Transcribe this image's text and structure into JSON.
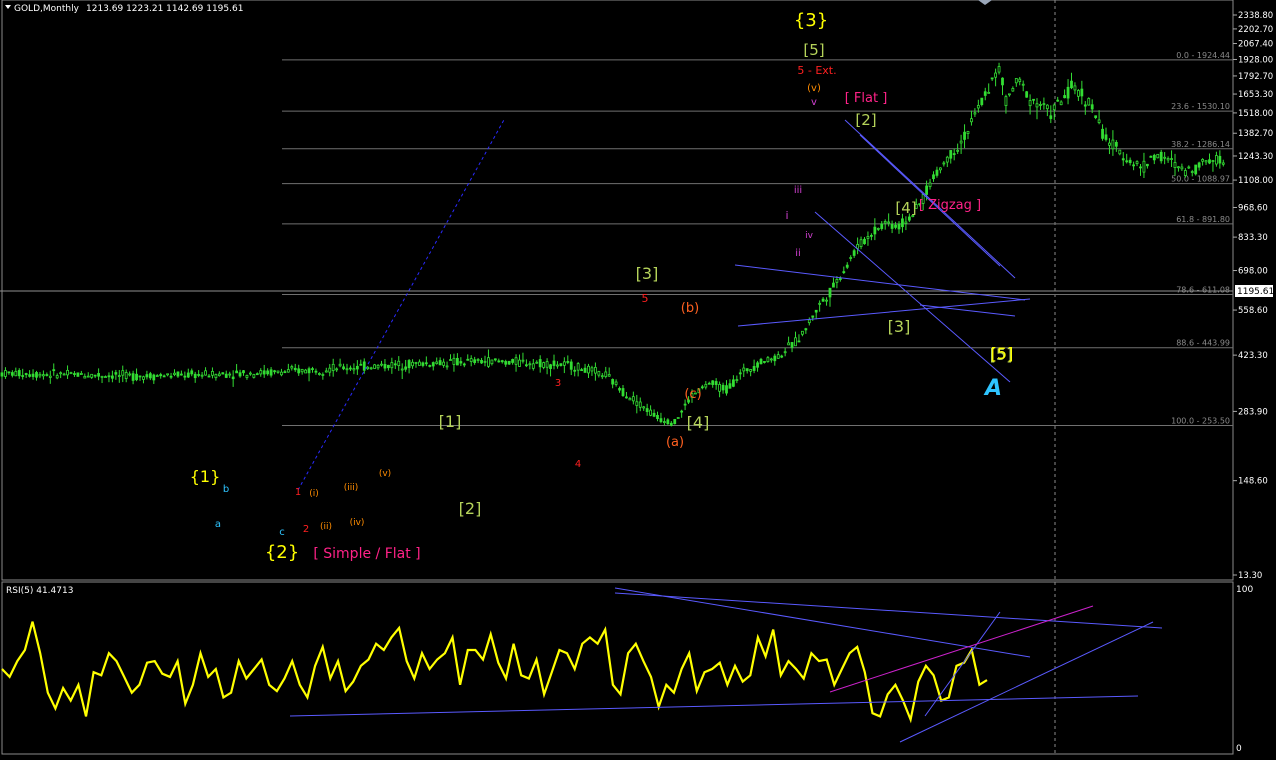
{
  "header": {
    "symbol": "GOLD,Monthly",
    "ohlc": "1213.69 1223.21 1142.69 1195.61"
  },
  "price_axis": {
    "ticks": [
      "2338.80",
      "2202.70",
      "2067.40",
      "1928.00",
      "1792.70",
      "1653.30",
      "1518.00",
      "1382.70",
      "1243.30",
      "1108.00",
      "968.60",
      "833.30",
      "698.00",
      "558.60",
      "423.30",
      "283.90",
      "148.60",
      "13.30"
    ],
    "current": "1195.61"
  },
  "fib_levels": [
    "0.0 - 1924.44",
    "23.6 - 1530.10",
    "38.2 - 1286.14",
    "50.0 - 1088.97",
    "61.8 - 891.80",
    "78.6 - 611.08",
    "88.6 - 443.99",
    "100.0 - 253.50"
  ],
  "rsi": {
    "title": "RSI(5) 41.4713",
    "scale_top": "100",
    "scale_bottom": "0"
  },
  "wave_labels": [
    {
      "t": "{3}",
      "c": "#ffff00"
    },
    {
      "t": "[5]",
      "c": "#b5d35a"
    },
    {
      "t": "5 - Ext.",
      "c": "#ff2020"
    },
    {
      "t": "(v)",
      "c": "#ff8c00"
    },
    {
      "t": "v",
      "c": "#d040d0"
    },
    {
      "t": "[ Flat ]",
      "c": "#ff2288"
    },
    {
      "t": "[2]",
      "c": "#b5d35a"
    },
    {
      "t": "[ Zigzag ]",
      "c": "#ff2288"
    },
    {
      "t": "[4]",
      "c": "#b5d35a"
    },
    {
      "t": "{1}",
      "c": "#ffff00"
    },
    {
      "t": "b",
      "c": "#2ec4ff"
    },
    {
      "t": "a",
      "c": "#2ec4ff"
    },
    {
      "t": "c",
      "c": "#2ec4ff"
    },
    {
      "t": "{2}",
      "c": "#ffff00"
    },
    {
      "t": "[ Simple / Flat ]",
      "c": "#ff2288"
    },
    {
      "t": "1",
      "c": "#ff2020"
    },
    {
      "t": "2",
      "c": "#ff2020"
    },
    {
      "t": "3",
      "c": "#ff2020"
    },
    {
      "t": "4",
      "c": "#ff2020"
    },
    {
      "t": "5",
      "c": "#ff2020"
    },
    {
      "t": "(i)",
      "c": "#ff8c00"
    },
    {
      "t": "(ii)",
      "c": "#ff8c00"
    },
    {
      "t": "(iii)",
      "c": "#ff8c00"
    },
    {
      "t": "(iv)",
      "c": "#ff8c00"
    },
    {
      "t": "(v)",
      "c": "#ff8c00"
    },
    {
      "t": "[1]",
      "c": "#b5d35a"
    },
    {
      "t": "[2]",
      "c": "#b5d35a"
    },
    {
      "t": "[3]",
      "c": "#b5d35a"
    },
    {
      "t": "[4]",
      "c": "#b5d35a"
    },
    {
      "t": "[5]",
      "c": "#b5d35a"
    },
    {
      "t": "(a)",
      "c": "#ff6020"
    },
    {
      "t": "(b)",
      "c": "#ff6020"
    },
    {
      "t": "(c)",
      "c": "#ff6020"
    },
    {
      "t": "i",
      "c": "#d040d0"
    },
    {
      "t": "ii",
      "c": "#d040d0"
    },
    {
      "t": "iii",
      "c": "#d040d0"
    },
    {
      "t": "iv",
      "c": "#d040d0"
    },
    {
      "t": "[3]",
      "c": "#b5d35a"
    },
    {
      "t": "[5]",
      "c": "#ffff00"
    }
  ],
  "colors": {
    "background": "#000000",
    "candles": "#33dd33",
    "rsi_line": "#ffff00",
    "trendline": "#5a5aff",
    "fib_line": "#707070",
    "channel": "#cc22cc",
    "logo": "#2ec4ff"
  },
  "chart_data": [
    {
      "type": "candlestick",
      "title": "GOLD,Monthly",
      "ohlc_last": {
        "open": 1213.69,
        "high": 1223.21,
        "low": 1142.69,
        "close": 1195.61
      },
      "ylim": [
        13.3,
        2338.8
      ],
      "close_path": [
        [
          0,
          375
        ],
        [
          20,
          372
        ],
        [
          40,
          368
        ],
        [
          60,
          372
        ],
        [
          80,
          378
        ],
        [
          100,
          390
        ],
        [
          120,
          400
        ],
        [
          140,
          407
        ],
        [
          155,
          402
        ],
        [
          165,
          395
        ],
        [
          175,
          370
        ],
        [
          180,
          330
        ],
        [
          185,
          300
        ],
        [
          190,
          270
        ],
        [
          195,
          260
        ],
        [
          200,
          320
        ],
        [
          205,
          350
        ],
        [
          210,
          335
        ],
        [
          215,
          380
        ],
        [
          220,
          405
        ],
        [
          225,
          420
        ],
        [
          230,
          460
        ],
        [
          233,
          500
        ],
        [
          236,
          560
        ],
        [
          240,
          620
        ],
        [
          244,
          700
        ],
        [
          248,
          790
        ],
        [
          252,
          850
        ],
        [
          256,
          900
        ],
        [
          260,
          880
        ],
        [
          265,
          950
        ],
        [
          270,
          1120
        ],
        [
          274,
          1230
        ],
        [
          277,
          1300
        ],
        [
          280,
          1400
        ],
        [
          283,
          1550
        ],
        [
          286,
          1700
        ],
        [
          289,
          1850
        ],
        [
          291,
          1600
        ],
        [
          293,
          1700
        ],
        [
          295,
          1750
        ],
        [
          298,
          1620
        ],
        [
          301,
          1580
        ],
        [
          304,
          1520
        ],
        [
          307,
          1600
        ],
        [
          310,
          1700
        ],
        [
          313,
          1650
        ],
        [
          316,
          1560
        ],
        [
          319,
          1380
        ],
        [
          322,
          1300
        ],
        [
          325,
          1250
        ],
        [
          328,
          1200
        ],
        [
          331,
          1180
        ],
        [
          334,
          1250
        ],
        [
          337,
          1230
        ],
        [
          340,
          1190
        ],
        [
          343,
          1160
        ],
        [
          346,
          1180
        ],
        [
          349,
          1220
        ],
        [
          352,
          1230
        ],
        [
          355,
          1195
        ]
      ],
      "fib_retracement": [
        {
          "level": 0.0,
          "price": 1924.44
        },
        {
          "level": 23.6,
          "price": 1530.1
        },
        {
          "level": 38.2,
          "price": 1286.14
        },
        {
          "level": 50.0,
          "price": 1088.97
        },
        {
          "level": 61.8,
          "price": 891.8
        },
        {
          "level": 78.6,
          "price": 611.08
        },
        {
          "level": 88.6,
          "price": 443.99
        },
        {
          "level": 100.0,
          "price": 253.5
        }
      ]
    },
    {
      "type": "line",
      "title": "RSI(5) 41.4713",
      "ylim": [
        0,
        100
      ],
      "last_value": 41.4713,
      "values": [
        50,
        45,
        55,
        62,
        80,
        60,
        35,
        25,
        38,
        30,
        40,
        20,
        48,
        46,
        60,
        55,
        45,
        35,
        40,
        54,
        55,
        47,
        45,
        55,
        28,
        40,
        60,
        45,
        50,
        32,
        35,
        55,
        44,
        50,
        56,
        40,
        36,
        44,
        55,
        40,
        32,
        52,
        64,
        44,
        55,
        36,
        42,
        52,
        56,
        66,
        62,
        70,
        76,
        55,
        44,
        60,
        50,
        56,
        60,
        70,
        40,
        62,
        62,
        56,
        72,
        54,
        44,
        66,
        46,
        44,
        56,
        34,
        48,
        62,
        60,
        50,
        66,
        70,
        66,
        75,
        40,
        34,
        60,
        66,
        55,
        45,
        26,
        40,
        35,
        50,
        60,
        36,
        48,
        50,
        54,
        40,
        52,
        42,
        46,
        70,
        58,
        75,
        46,
        55,
        50,
        44,
        60,
        55,
        56,
        40,
        50,
        60,
        64,
        48,
        22,
        20,
        34,
        40,
        30,
        18,
        42,
        52,
        46,
        30,
        32,
        52,
        54,
        62,
        40,
        43
      ]
    }
  ]
}
